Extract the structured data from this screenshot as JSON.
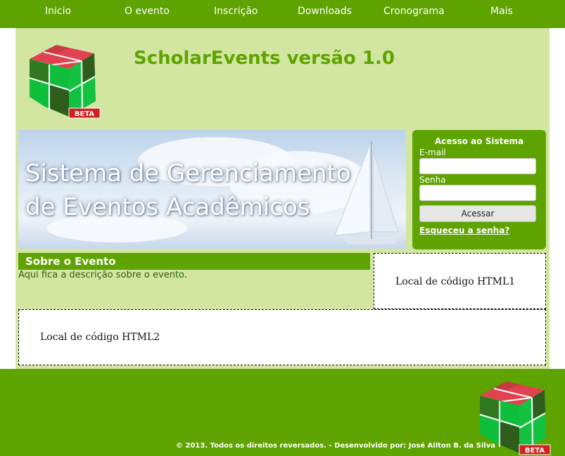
{
  "nav": {
    "items": [
      {
        "label": "Inicio"
      },
      {
        "label": "O evento"
      },
      {
        "label": "Inscrição"
      },
      {
        "label": "Downloads"
      },
      {
        "label": "Cronograma"
      },
      {
        "label": "Mais"
      }
    ]
  },
  "header": {
    "title": "ScholarEvents versão 1.0",
    "logo_badge": "BETA"
  },
  "banner": {
    "line1": "Sistema de Gerenciamento",
    "line2": "de Eventos Acadêmicos"
  },
  "login": {
    "title": "Acesso ao Sistema",
    "email_label": "E-mail",
    "email_value": "",
    "password_label": "Senha",
    "password_value": "",
    "submit_label": "Acessar",
    "forgot_label": "Esqueceu a senha?"
  },
  "sobre": {
    "title": "Sobre o Evento",
    "description": "Aqui fica a descrição sobre o evento."
  },
  "html_blocks": {
    "block1": "Local de código HTML1",
    "block2": "Local de código HTML2"
  },
  "footer": {
    "copyright": "© 2013. Todos os direitos reversados. - Desenvolvido por: José Ailton B. da Silva",
    "logo_badge": "BETA"
  },
  "colors": {
    "primary_green": "#5fa300",
    "content_bg": "#d2e6a2",
    "cube_red": "#e0424f",
    "cube_green": "#0fbf3b",
    "cube_dark": "#2f5e1c"
  }
}
